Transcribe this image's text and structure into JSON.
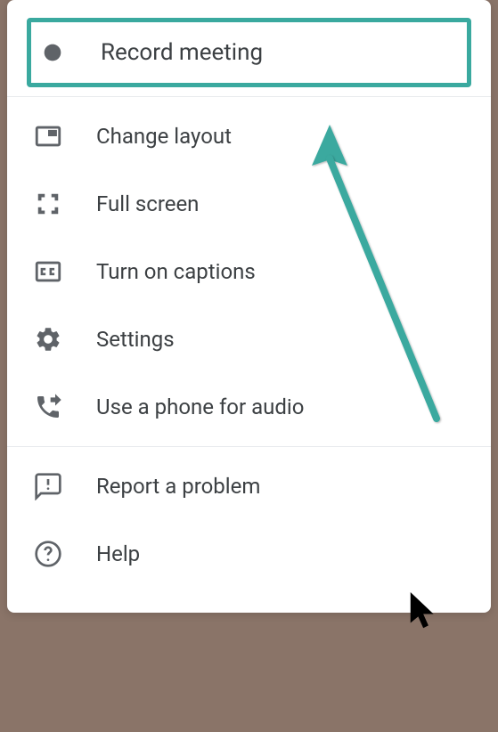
{
  "menu": {
    "record": {
      "label": "Record meeting"
    },
    "layout": {
      "label": "Change layout"
    },
    "fullscreen": {
      "label": "Full screen"
    },
    "captions": {
      "label": "Turn on captions"
    },
    "settings": {
      "label": "Settings"
    },
    "phone": {
      "label": "Use a phone for audio"
    },
    "report": {
      "label": "Report a problem"
    },
    "help": {
      "label": "Help"
    }
  },
  "colors": {
    "accent": "#3aa99f",
    "iconGray": "#5f6368",
    "textGray": "#3c4043"
  }
}
